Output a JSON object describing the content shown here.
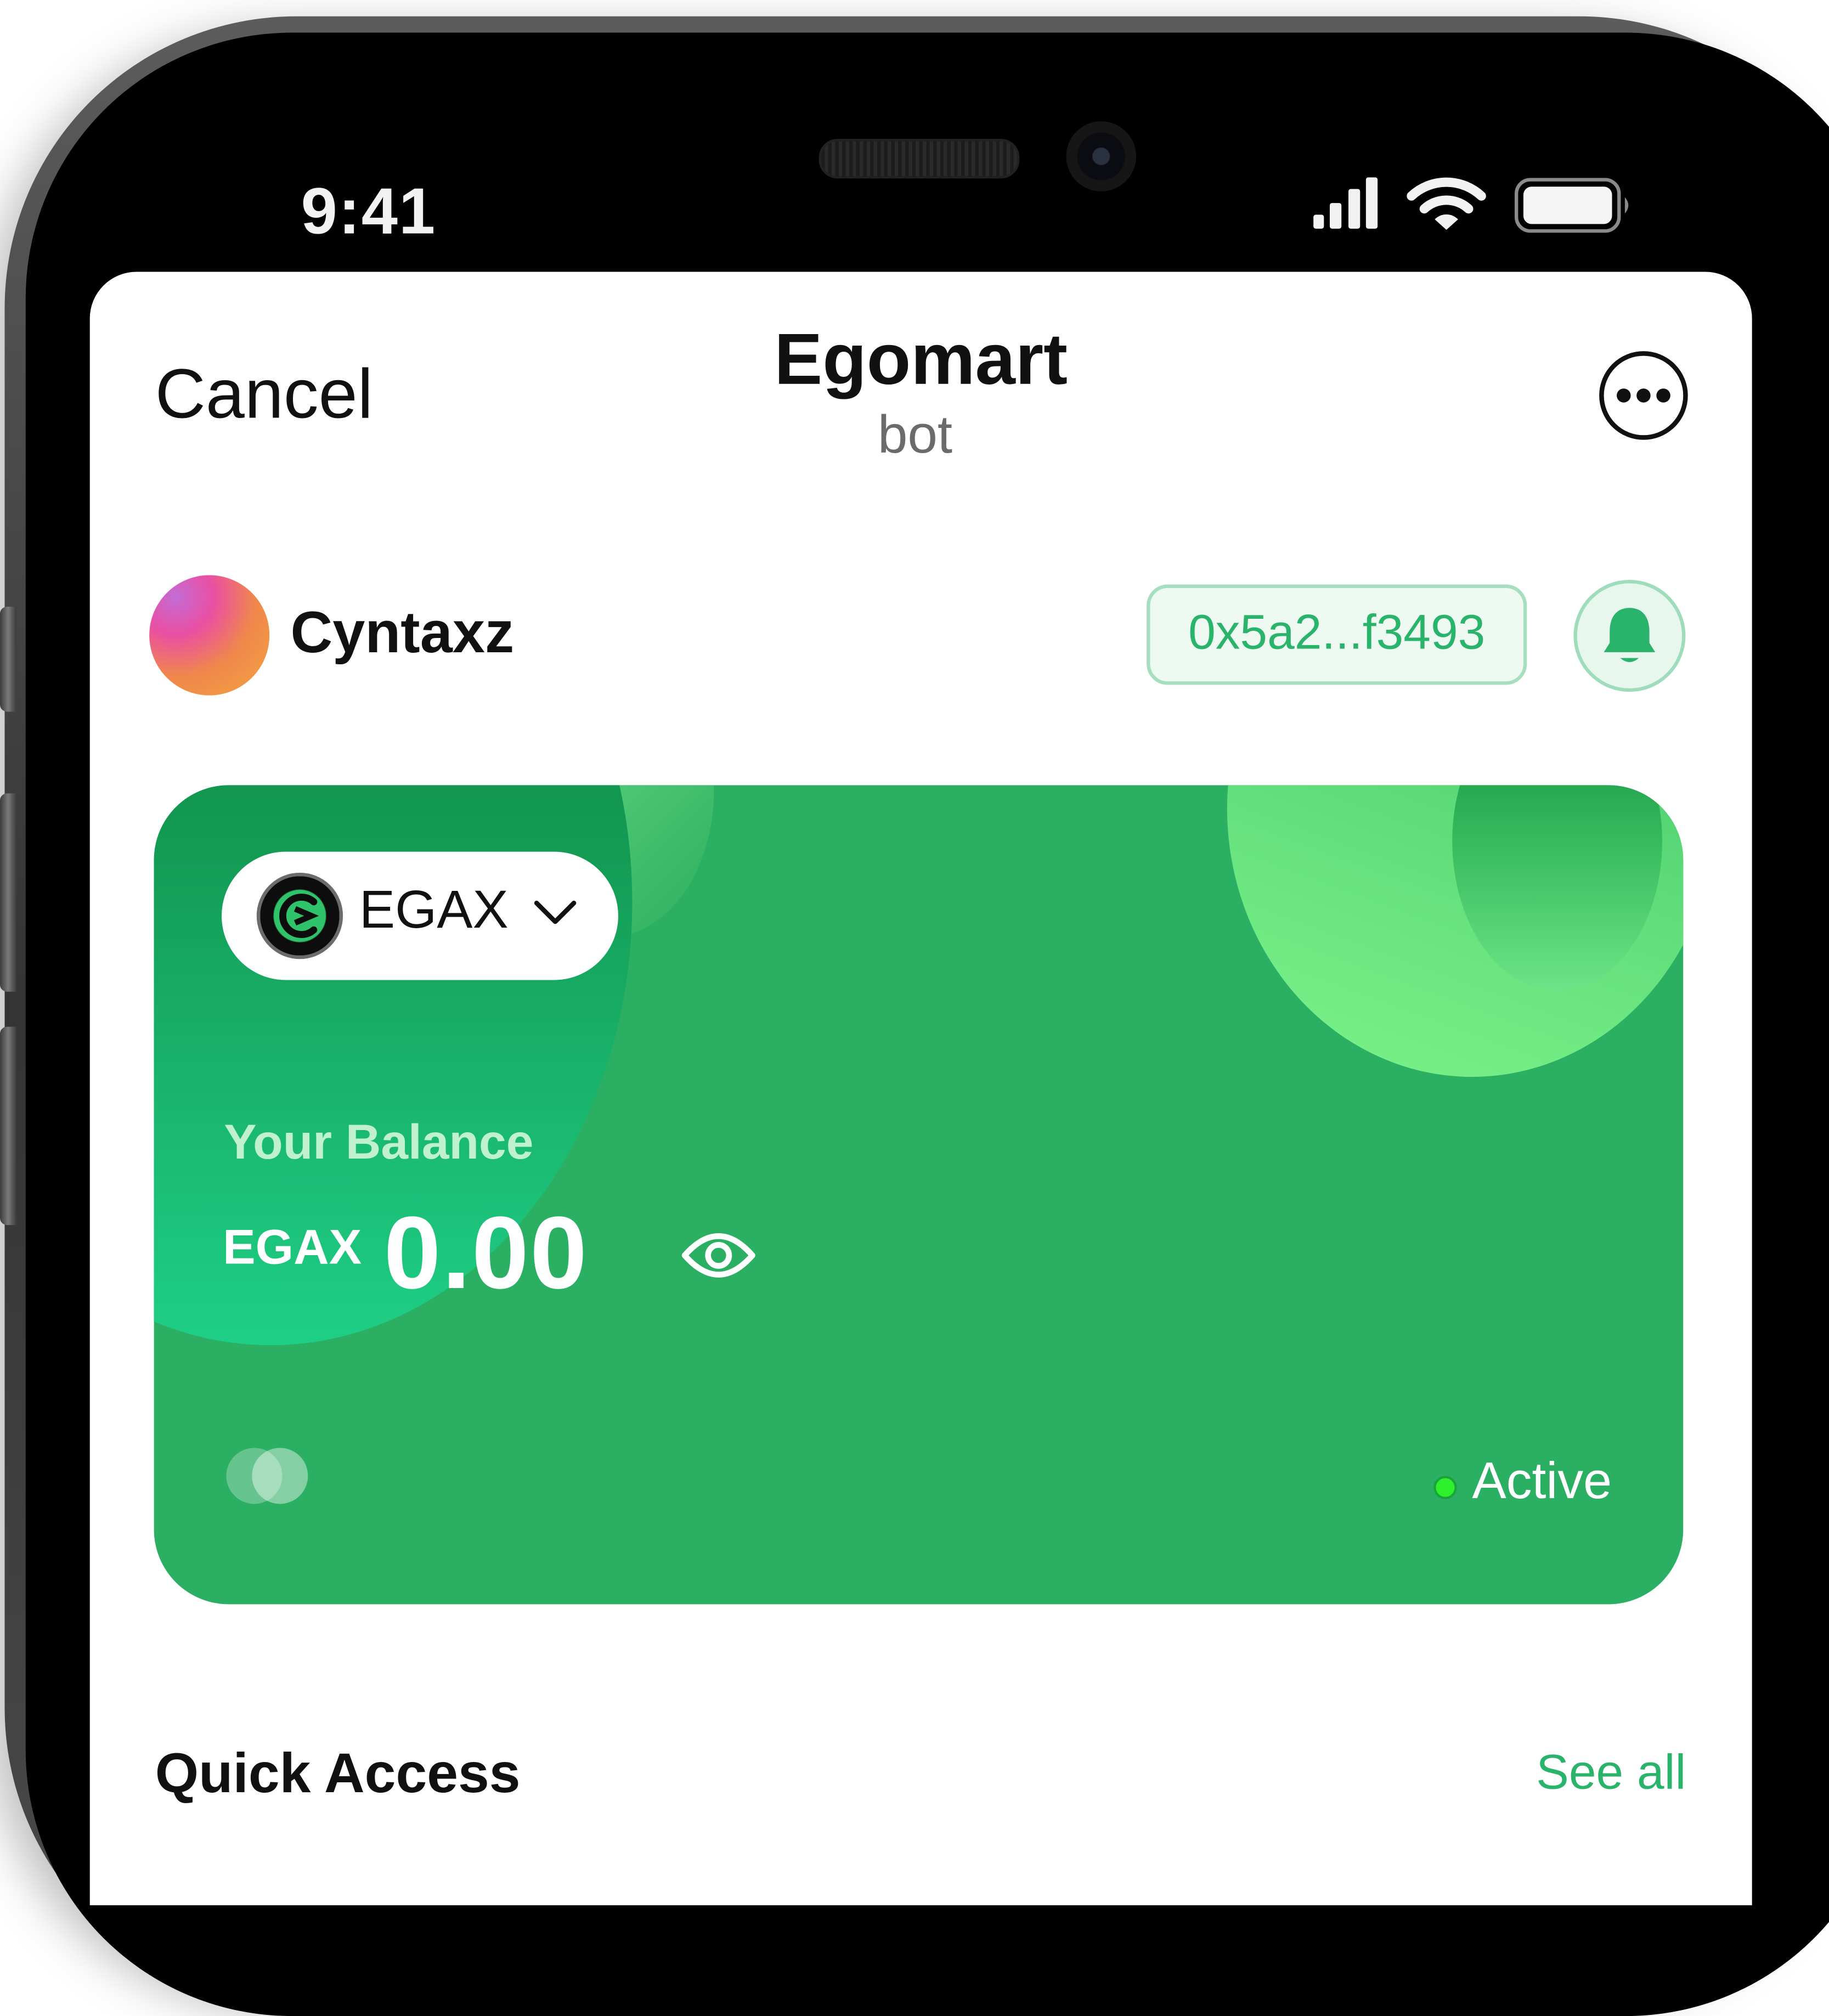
{
  "status_bar": {
    "time": "9:41",
    "icons": [
      "cellular-signal-icon",
      "wifi-icon",
      "battery-icon"
    ]
  },
  "header": {
    "cancel_label": "Cancel",
    "title": "Egomart",
    "subtitle": "bot",
    "more_icon": "more-horizontal-icon"
  },
  "profile": {
    "username": "Cyntaxz",
    "wallet_address": "0x5a2...f3493",
    "notification_icon": "bell-icon"
  },
  "wallet_card": {
    "token_label": "EGAX",
    "dropdown_icon": "chevron-down-icon",
    "balance_label": "Your Balance",
    "balance_currency": "EGAX",
    "balance_value": "0.00",
    "visibility_icon": "eye-icon",
    "status_label": "Active",
    "colors": {
      "card": "#2baf63",
      "status_dot": "#2ef02c",
      "balance_label": "#bff1cf"
    }
  },
  "quick_access": {
    "title": "Quick Access",
    "see_all_label": "See all"
  },
  "colors": {
    "accent": "#2ab36a",
    "address_border": "#a6dfbf",
    "address_bg": "#eef9f2"
  }
}
